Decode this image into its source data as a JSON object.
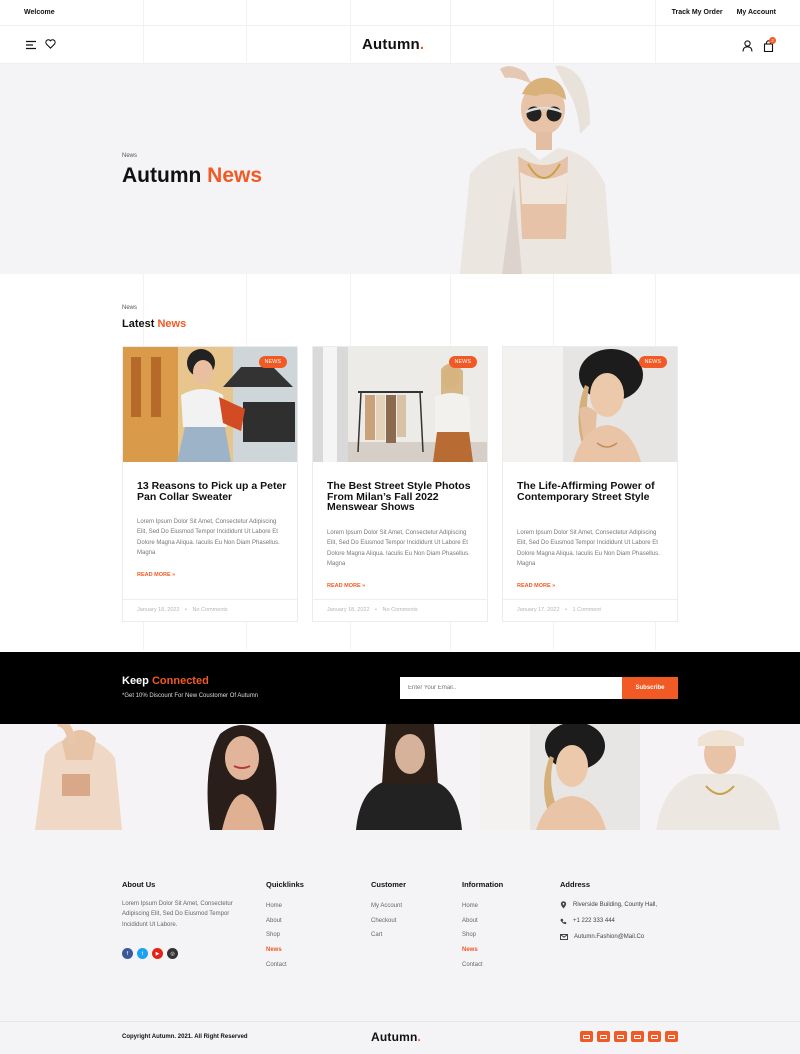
{
  "topbar": {
    "welcome": "Welcome",
    "track_order": "Track My Order",
    "my_account": "My Account"
  },
  "header": {
    "logo_text": "Autumn",
    "logo_dot": ".",
    "cart_count": "2"
  },
  "hero": {
    "crumb": "News",
    "title_plain": "Autumn ",
    "title_accent": "News"
  },
  "latest": {
    "crumb": "News",
    "title_plain": "Latest ",
    "title_accent": "News",
    "cards": [
      {
        "badge": "NEWS",
        "title": "13 Reasons to Pick up a Peter Pan Collar Sweater",
        "excerpt": "Lorem Ipsum Dolor Sit Amet, Consectetur Adipiscing Elit, Sed Do Eiusmod Tempor Incididunt Ut Labore Et Dolore Magna Aliqua. Iaculis Eu Non Diam Phasellus. Magna",
        "more": "READ MORE »",
        "date": "January 18, 2022",
        "comments": "No Comments"
      },
      {
        "badge": "NEWS",
        "title": "The Best Street Style Photos From Milan’s Fall 2022 Menswear Shows",
        "excerpt": "Lorem Ipsum Dolor Sit Amet, Consectetur Adipiscing Elit, Sed Do Eiusmod Tempor Incididunt Ut Labore Et Dolore Magna Aliqua. Iaculis Eu Non Diam Phasellus. Magna",
        "more": "READ MORE »",
        "date": "January 18, 2022",
        "comments": "No Comments"
      },
      {
        "badge": "NEWS",
        "title": "The Life-Affirming Power of Contemporary Street Style",
        "excerpt": "Lorem Ipsum Dolor Sit Amet, Consectetur Adipiscing Elit, Sed Do Eiusmod Tempor Incididunt Ut Labore Et Dolore Magna Aliqua. Iaculis Eu Non Diam Phasellus. Magna",
        "more": "READ MORE »",
        "date": "January 17, 2022",
        "comments": "1 Comment"
      }
    ]
  },
  "newsletter": {
    "title_plain": "Keep ",
    "title_accent": "Connected",
    "subtitle": "*Get 10% Discount For New Coustomer Of Autumn",
    "placeholder": "Enter Your Email..",
    "button": "Subscribe"
  },
  "footer": {
    "about_heading": "About Us",
    "about_text": "Lorem Ipsum Dolor Sit Amet, Consectetur Adipiscing Elit, Sed Do Eiusmod Tempor Incididunt Ut Labore.",
    "quicklinks_heading": "Quicklinks",
    "quicklinks": [
      "Home",
      "About",
      "Shop",
      "News",
      "Contact"
    ],
    "customer_heading": "Customer",
    "customer": [
      "My Account",
      "Checkout",
      "Cart"
    ],
    "information_heading": "Information",
    "information": [
      "Home",
      "About",
      "Shop",
      "News",
      "Contact"
    ],
    "address_heading": "Address",
    "address": "Riverside Building, County Hall,",
    "phone": "+1 222 333 444",
    "email": "Autumn.Fashion@Mail.Co",
    "copyright": "Copyright Autumn. 2021. All Right Reserved",
    "logo_text": "Autumn",
    "logo_dot": "."
  },
  "colors": {
    "accent": "#f15a24",
    "hero_bg": "#f4f3f6",
    "band_bg": "#000000"
  },
  "icons": {
    "menu": "menu-icon",
    "wishlist": "heart-icon",
    "user": "user-icon",
    "cart": "bag-icon"
  }
}
